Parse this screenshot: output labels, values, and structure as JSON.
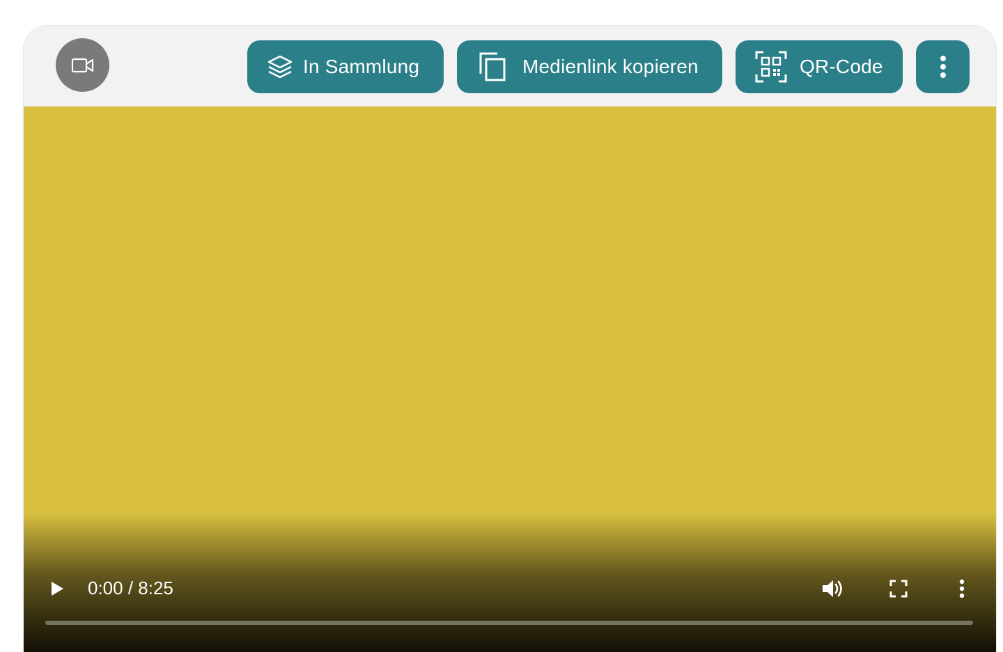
{
  "toolbar": {
    "media_type_icon": "video-camera-icon",
    "collection_button": {
      "label": "In Sammlung",
      "icon": "layers-icon"
    },
    "copy_link_button": {
      "label": "Medienlink kopieren",
      "icon": "copy-icon"
    },
    "qr_button": {
      "label": "QR-Code",
      "icon": "qr-code-icon"
    },
    "more_button": {
      "icon": "more-vertical-icon"
    }
  },
  "player": {
    "time_display": "0:00 / 8:25",
    "progress": 0,
    "icons": {
      "play": "play-icon",
      "volume": "volume-icon",
      "fullscreen": "fullscreen-icon",
      "menu": "more-vertical-icon"
    }
  },
  "colors": {
    "accent": "#2a7f89",
    "video_background": "#d8bf3f",
    "toolbar_background": "#f2f2f2",
    "media_badge": "#7a7a7a"
  }
}
